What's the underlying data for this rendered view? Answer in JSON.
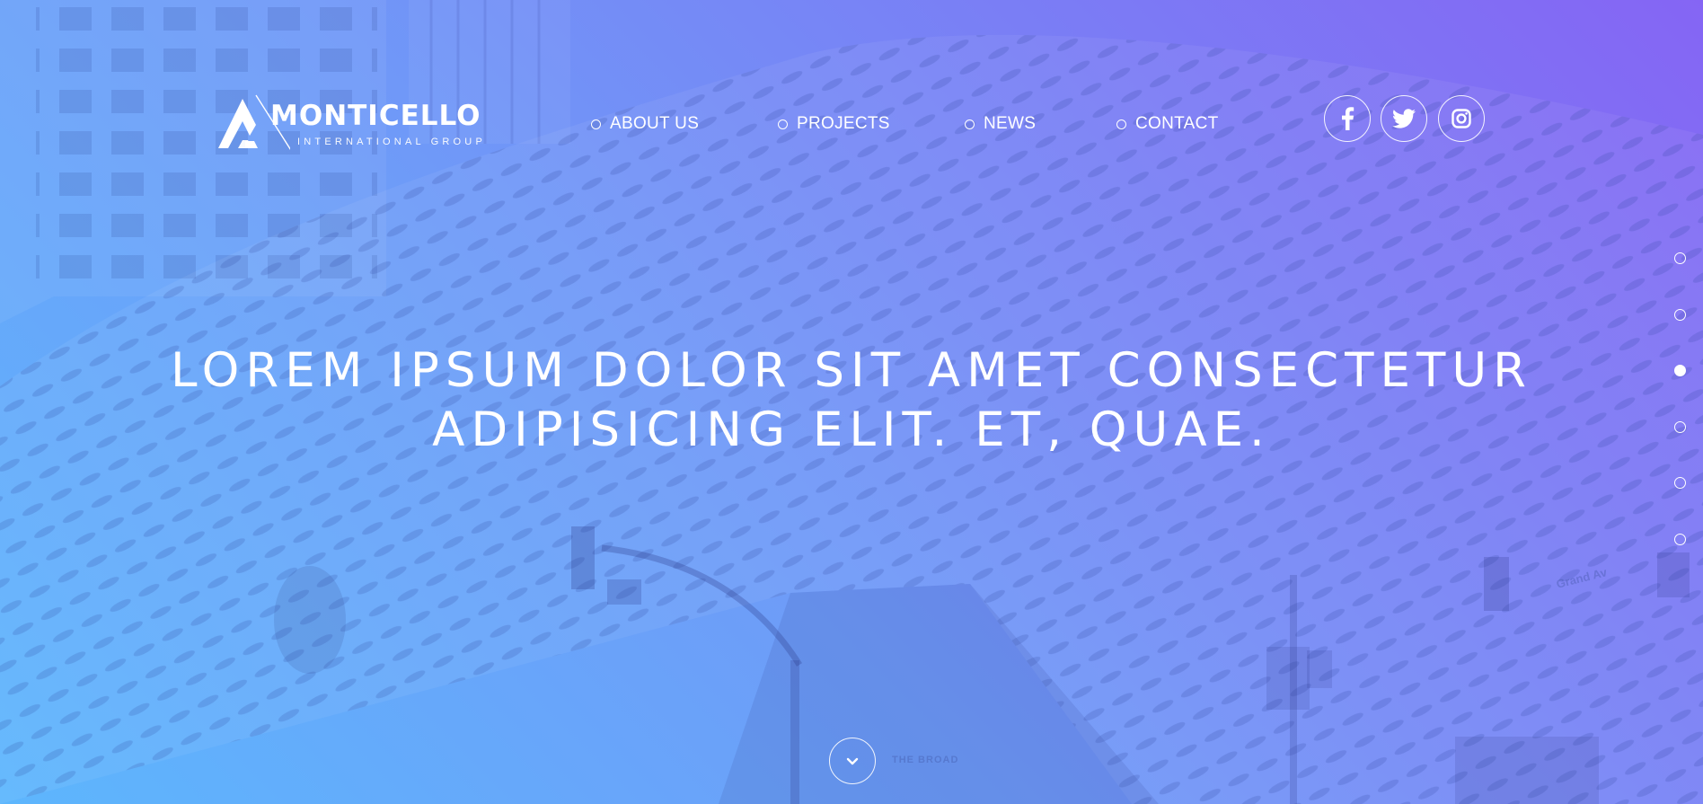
{
  "brand": {
    "name": "MONTICELLO",
    "tagline": "INTERNATIONAL GROUP"
  },
  "nav": {
    "items": [
      {
        "label": "ABOUT US"
      },
      {
        "label": "PROJECTS"
      },
      {
        "label": "NEWS"
      },
      {
        "label": "CONTACT"
      }
    ]
  },
  "social": {
    "icons": [
      "facebook-icon",
      "twitter-icon",
      "instagram-icon"
    ]
  },
  "hero": {
    "headline_line1": "LOREM IPSUM DOLOR SIT AMET CONSECTETUR",
    "headline_line2": "ADIPISICING ELIT. ET, QUAE.",
    "backdrop_sign": "THE BROAD",
    "street_sign": "Grand Av"
  },
  "pager": {
    "count": 6,
    "active_index": 2
  },
  "colors": {
    "gradient_start": "#5db6fd",
    "gradient_end": "#8565f4",
    "text": "#ffffff"
  }
}
